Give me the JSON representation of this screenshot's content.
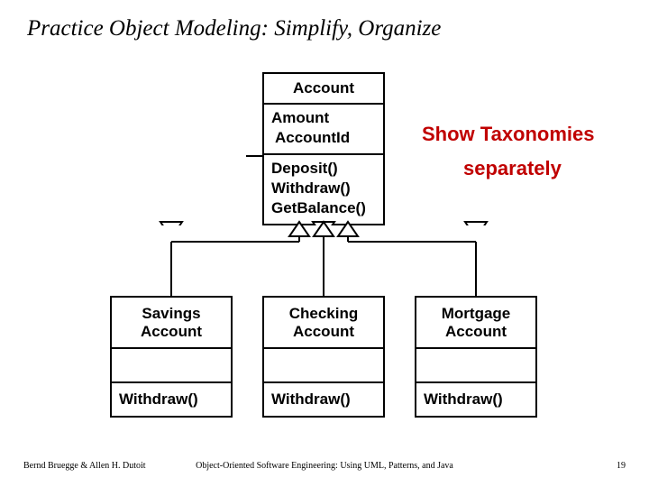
{
  "title": "Practice Object Modeling: Simplify, Organize",
  "annotation": {
    "line1": "Show Taxonomies",
    "line2": "separately"
  },
  "parent": {
    "name": "Account",
    "attr1": "Amount",
    "attr2": "AccountId",
    "op1": "Deposit()",
    "op2": "Withdraw()",
    "op3": "GetBalance()"
  },
  "children": [
    {
      "name": "Savings Account",
      "op": "Withdraw()"
    },
    {
      "name": "Checking Account",
      "op": "Withdraw()"
    },
    {
      "name": "Mortgage Account",
      "op": "Withdraw()"
    }
  ],
  "footer": {
    "left": "Bernd Bruegge & Allen H. Dutoit",
    "center": "Object-Oriented Software Engineering: Using UML, Patterns, and Java",
    "right": "19"
  }
}
